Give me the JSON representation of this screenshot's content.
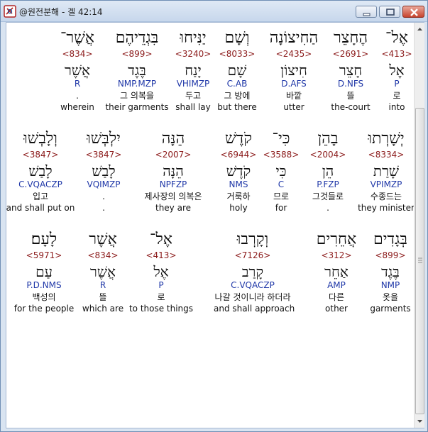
{
  "window": {
    "title": "@원전분해 - 겔 42:14"
  },
  "rows": [
    {
      "words": [
        {
          "heb": "אֶל־",
          "num": "<413>",
          "lemma": "אֶל",
          "morph": "P",
          "kor": "로",
          "eng": "into"
        },
        {
          "heb": "הֶחָצֵר",
          "num": "<2691>",
          "lemma": "חָצֵר",
          "morph": "D.NFS",
          "kor": "뜰",
          "eng": "the-court"
        },
        {
          "heb": "הַחִיצוֹנָה",
          "num": "<2435>",
          "lemma": "חִיצוֹן",
          "morph": "D.AFS",
          "kor": "바깥",
          "eng": "utter"
        },
        {
          "heb": "וְשָׁם",
          "num": "<8033>",
          "lemma": "שָׁם",
          "morph": "C.AB",
          "kor": "그 방에",
          "eng": "but there"
        },
        {
          "heb": "יַנִּיחוּ",
          "num": "<3240>",
          "lemma": "יָנַח",
          "morph": "VHIMZP",
          "kor": "두고",
          "eng": "shall lay"
        },
        {
          "heb": "בִּגְדֵיהֶם",
          "num": "<899>",
          "lemma": "בֶּגֶד",
          "morph": "NMP.MZP",
          "kor": "그 의복을",
          "eng": "their garments"
        },
        {
          "heb": "אֲשֶׁר־",
          "num": "<834>",
          "lemma": "אֲשֶׁר",
          "morph": "R",
          "kor": ".",
          "eng": "wherein"
        }
      ]
    },
    {
      "words": [
        {
          "heb": "יְשָׁרְתוּ",
          "num": "<8334>",
          "lemma": "שָׁרַת",
          "morph": "VPIMZP",
          "kor": "수종드는",
          "eng": "they minister"
        },
        {
          "heb": "בָהֵן",
          "num": "<2004>",
          "lemma": "הֵן",
          "morph": "P.FZP",
          "kor": "그것들로",
          "eng": "."
        },
        {
          "heb": "כִּי־",
          "num": "<3588>",
          "lemma": "כִּי",
          "morph": "C",
          "kor": "므로",
          "eng": "for"
        },
        {
          "heb": "קֹדֶשׁ",
          "num": "<6944>",
          "lemma": "קֹדֶשׁ",
          "morph": "NMS",
          "kor": "거룩하",
          "eng": "holy"
        },
        {
          "heb": "הֵנָּה",
          "num": "<2007>",
          "lemma": "הֵנָּה",
          "morph": "NPFZP",
          "kor": "제사장의 의복은",
          "eng": "they are"
        },
        {
          "heb": "יִלְבְּשׁוּ",
          "num": "<3847>",
          "lemma": "לָבַשׁ",
          "morph": "VQIMZP",
          "kor": ".",
          "eng": "."
        },
        {
          "heb": "וְלָבְשׁוּ",
          "num": "<3847>",
          "lemma": "לָבַשׁ",
          "morph": "C.VQACZP",
          "kor": "입고",
          "eng": "and shall put on"
        }
      ]
    },
    {
      "words": [
        {
          "heb": "בְּגָדִים",
          "num": "<899>",
          "lemma": "בֶּגֶד",
          "morph": "NMP",
          "kor": "옷을",
          "eng": "garments"
        },
        {
          "heb": "אֲחֵרִים",
          "num": "<312>",
          "lemma": "אַחֵר",
          "morph": "AMP",
          "kor": "다른",
          "eng": "other"
        },
        {
          "heb": "וְקָרְבוּ",
          "num": "<7126>",
          "lemma": "קָרַב",
          "morph": "C.VQACZP",
          "kor": "나갈 것이니라 하더라",
          "eng": "and shall approach"
        },
        {
          "heb": "אֶל־",
          "num": "<413>",
          "lemma": "אֶל",
          "morph": "P",
          "kor": "로",
          "eng": "to those things"
        },
        {
          "heb": "אֲשֶׁר",
          "num": "<834>",
          "lemma": "אֲשֶׁר",
          "morph": "R",
          "kor": "뜰",
          "eng": "which are"
        },
        {
          "heb": "לָעָם׃",
          "num": "<5971>",
          "lemma": "עַם",
          "morph": "P.D.NMS",
          "kor": "백성의",
          "eng": "for the people"
        }
      ]
    }
  ],
  "icons": {
    "app": "hebrew-lexicon-app-icon",
    "minimize": "minimize-icon",
    "maximize": "maximize-icon",
    "close": "close-icon",
    "scroll_up": "chevron-up-icon",
    "scroll_down": "chevron-down-icon"
  },
  "colors": {
    "hebrew": "#111111",
    "strong_number": "#8b1a1a",
    "morphology": "#2038a8",
    "gloss": "#111111"
  }
}
